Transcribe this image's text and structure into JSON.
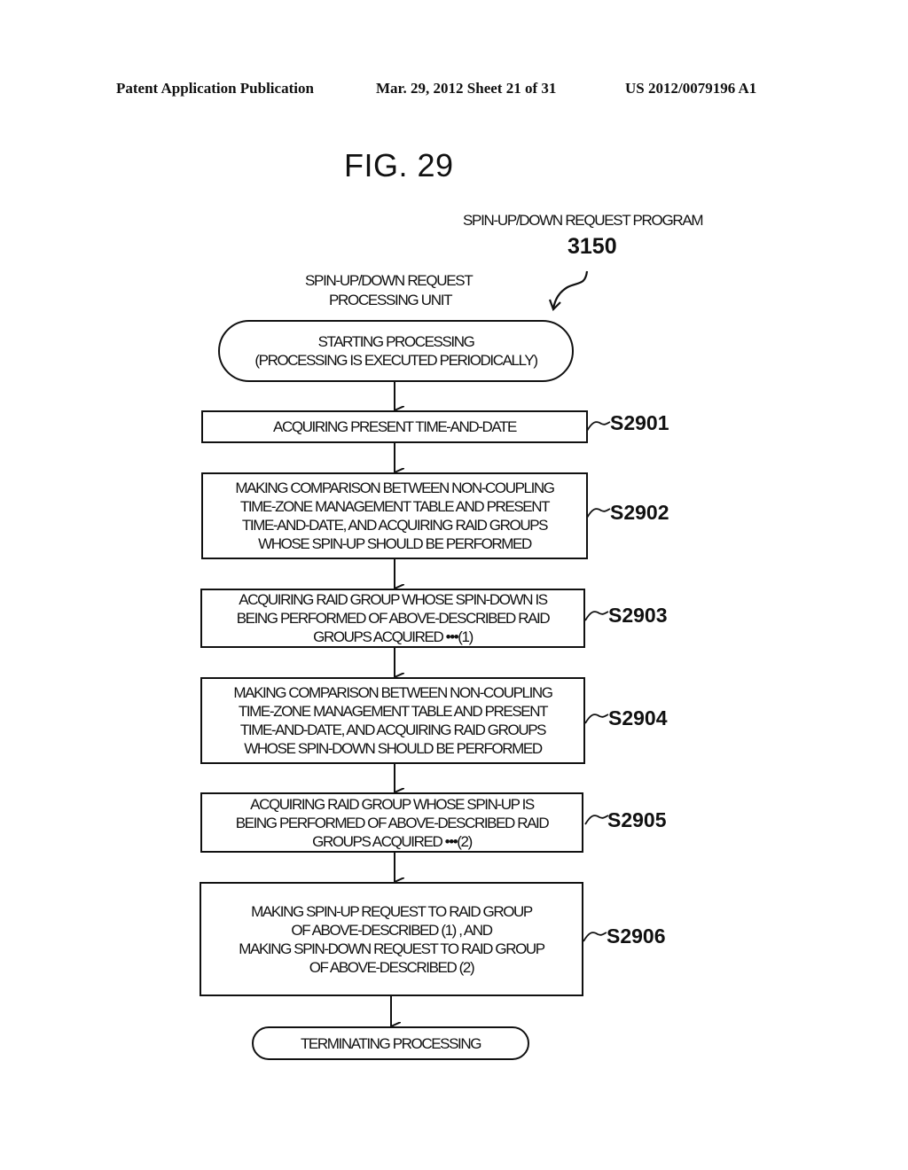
{
  "header": {
    "publication": "Patent Application Publication",
    "date_sheet": "Mar. 29, 2012  Sheet 21 of 31",
    "patent_number": "US 2012/0079196 A1"
  },
  "figure": {
    "title": "FIG. 29",
    "program_label": "SPIN-UP/DOWN REQUEST PROGRAM",
    "program_ref": "3150",
    "unit_label_line1": "SPIN-UP/DOWN REQUEST",
    "unit_label_line2": "PROCESSING UNIT"
  },
  "flow": {
    "start": "STARTING PROCESSING\n(PROCESSING IS EXECUTED PERIODICALLY)",
    "steps": [
      {
        "id": "S2901",
        "text": "ACQUIRING PRESENT TIME-AND-DATE"
      },
      {
        "id": "S2902",
        "text": "MAKING COMPARISON BETWEEN NON-COUPLING\nTIME-ZONE MANAGEMENT TABLE AND PRESENT\nTIME-AND-DATE, AND ACQUIRING RAID GROUPS\nWHOSE SPIN-UP SHOULD BE PERFORMED"
      },
      {
        "id": "S2903",
        "text": "ACQUIRING RAID GROUP WHOSE SPIN-DOWN IS\nBEING PERFORMED OF ABOVE-DESCRIBED RAID\nGROUPS ACQUIRED •••(1)"
      },
      {
        "id": "S2904",
        "text": "MAKING COMPARISON BETWEEN NON-COUPLING\nTIME-ZONE MANAGEMENT TABLE AND PRESENT\nTIME-AND-DATE, AND ACQUIRING RAID GROUPS\nWHOSE SPIN-DOWN SHOULD BE PERFORMED"
      },
      {
        "id": "S2905",
        "text": "ACQUIRING RAID GROUP WHOSE SPIN-UP IS\nBEING PERFORMED OF ABOVE-DESCRIBED RAID\nGROUPS ACQUIRED •••(2)"
      },
      {
        "id": "S2906",
        "text": "MAKING SPIN-UP REQUEST TO RAID GROUP\nOF ABOVE-DESCRIBED (1) , AND\nMAKING SPIN-DOWN REQUEST TO RAID GROUP\nOF ABOVE-DESCRIBED (2)"
      }
    ],
    "end": "TERMINATING PROCESSING"
  }
}
